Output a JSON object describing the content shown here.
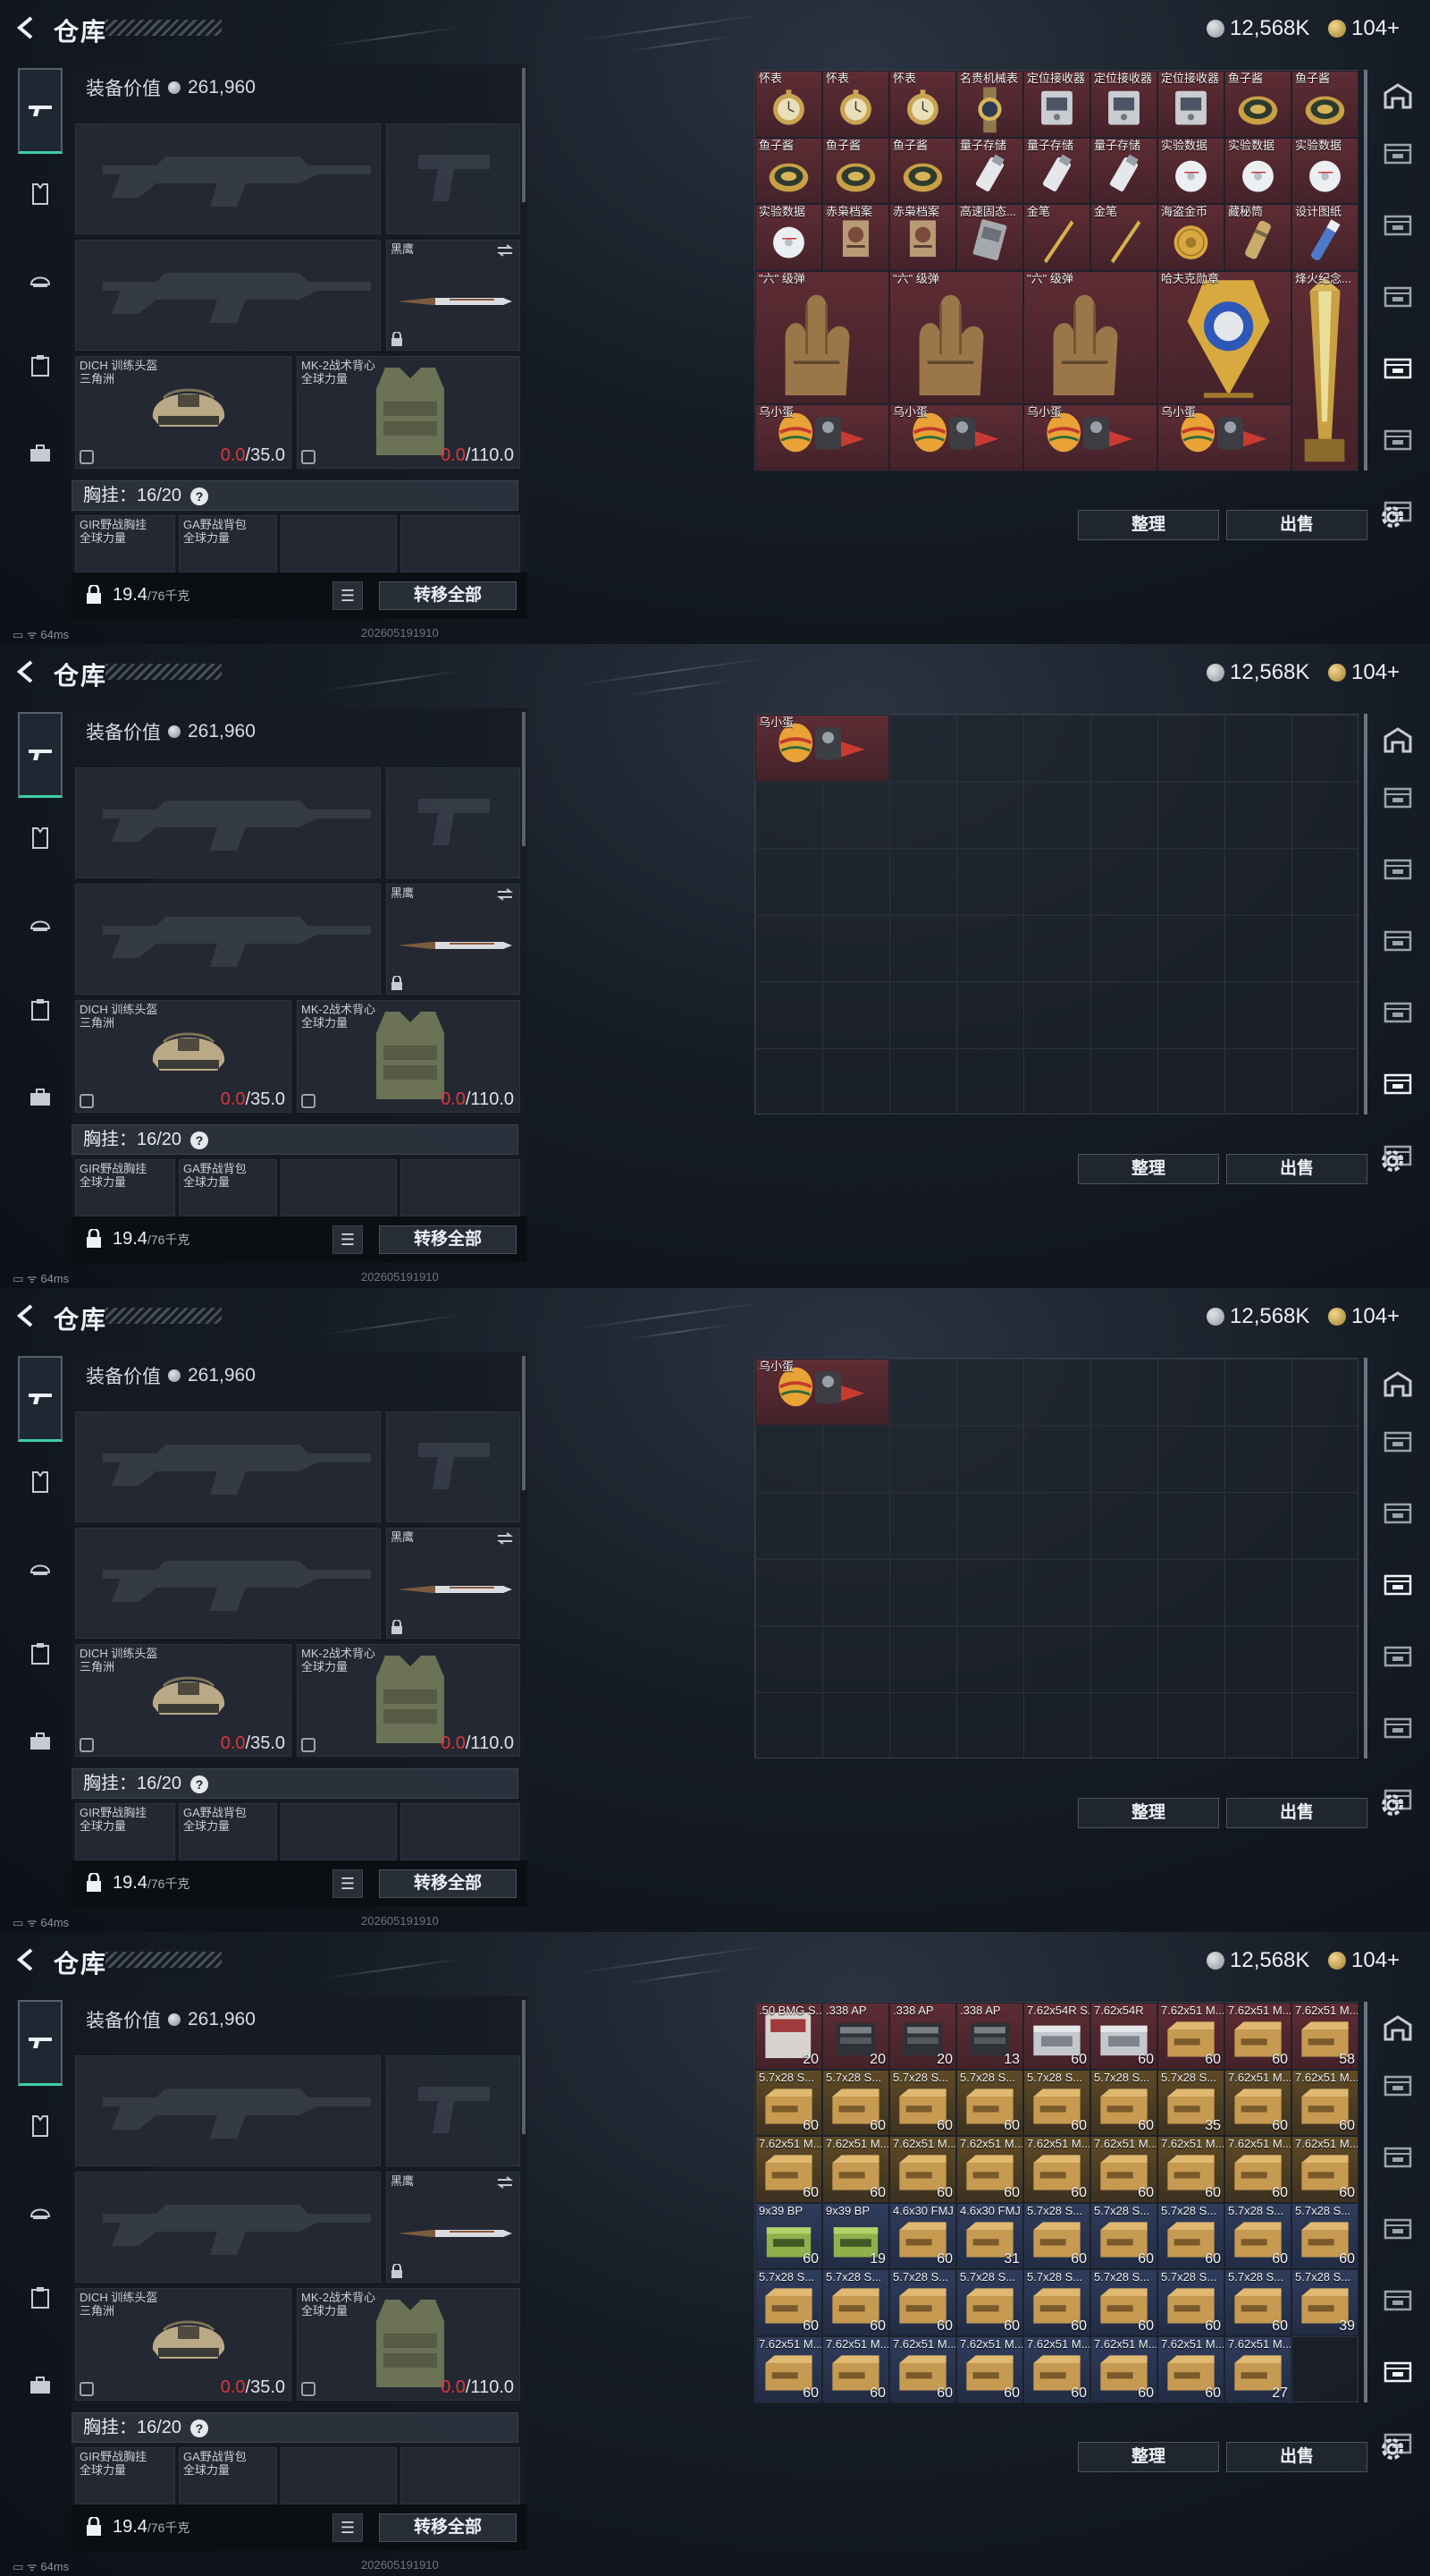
{
  "header": {
    "title": "仓库",
    "silver": "12,568K",
    "gold": "104+"
  },
  "equipment": {
    "value_label": "装备价值",
    "value": "261,960",
    "knife_label": "黑鹰",
    "helmet": {
      "name": "DICH 训练头盔",
      "sub": "三角洲",
      "cur": "0.0",
      "max": "/35.0"
    },
    "armor": {
      "name": "MK-2战术背心",
      "sub": "全球力量",
      "cur": "0.0",
      "max": "/110.0"
    },
    "chest_label": "胸挂：16/20",
    "bag1": {
      "name": "GIR野战胸挂",
      "sub": "全球力量"
    },
    "bag2": {
      "name": "GA野战背包",
      "sub": "全球力量"
    },
    "weight": "19.4",
    "weight_max": "/76千克",
    "transfer_label": "转移全部"
  },
  "actions": {
    "sort": "整理",
    "sell": "出售"
  },
  "status": {
    "ping": "64ms",
    "stamp": "202605191910"
  },
  "icons": [
    "back-icon",
    "gun-icon",
    "armor-icon",
    "helmet-icon",
    "clipboard-icon",
    "briefcase-icon",
    "gear-icon",
    "lock-icon",
    "list-icon",
    "help-icon"
  ],
  "panels": [
    {
      "cells": [
        {
          "c": 0,
          "r": 0,
          "w": 1,
          "h": 1,
          "label": "怀表",
          "bg": "red",
          "art": "watch"
        },
        {
          "c": 1,
          "r": 0,
          "w": 1,
          "h": 1,
          "label": "怀表",
          "bg": "red",
          "art": "watch"
        },
        {
          "c": 2,
          "r": 0,
          "w": 1,
          "h": 1,
          "label": "怀表",
          "bg": "red",
          "art": "watch"
        },
        {
          "c": 3,
          "r": 0,
          "w": 1,
          "h": 1,
          "label": "名贵机械表",
          "bg": "red",
          "art": "wrist"
        },
        {
          "c": 4,
          "r": 0,
          "w": 1,
          "h": 1,
          "label": "定位接收器",
          "bg": "red",
          "art": "device"
        },
        {
          "c": 5,
          "r": 0,
          "w": 1,
          "h": 1,
          "label": "定位接收器",
          "bg": "red",
          "art": "device"
        },
        {
          "c": 6,
          "r": 0,
          "w": 1,
          "h": 1,
          "label": "定位接收器",
          "bg": "red",
          "art": "device"
        },
        {
          "c": 7,
          "r": 0,
          "w": 1,
          "h": 1,
          "label": "鱼子酱",
          "bg": "red",
          "art": "tin"
        },
        {
          "c": 8,
          "r": 0,
          "w": 1,
          "h": 1,
          "label": "鱼子酱",
          "bg": "red",
          "art": "tin"
        },
        {
          "c": 0,
          "r": 1,
          "w": 1,
          "h": 1,
          "label": "鱼子酱",
          "bg": "red",
          "art": "tin"
        },
        {
          "c": 1,
          "r": 1,
          "w": 1,
          "h": 1,
          "label": "鱼子酱",
          "bg": "red",
          "art": "tin"
        },
        {
          "c": 2,
          "r": 1,
          "w": 1,
          "h": 1,
          "label": "鱼子酱",
          "bg": "red",
          "art": "tin"
        },
        {
          "c": 3,
          "r": 1,
          "w": 1,
          "h": 1,
          "label": "量子存储",
          "bg": "red",
          "art": "usb"
        },
        {
          "c": 4,
          "r": 1,
          "w": 1,
          "h": 1,
          "label": "量子存储",
          "bg": "red",
          "art": "usb"
        },
        {
          "c": 5,
          "r": 1,
          "w": 1,
          "h": 1,
          "label": "量子存储",
          "bg": "red",
          "art": "usb"
        },
        {
          "c": 6,
          "r": 1,
          "w": 1,
          "h": 1,
          "label": "实验数据",
          "bg": "red",
          "art": "disc"
        },
        {
          "c": 7,
          "r": 1,
          "w": 1,
          "h": 1,
          "label": "实验数据",
          "bg": "red",
          "art": "disc"
        },
        {
          "c": 8,
          "r": 1,
          "w": 1,
          "h": 1,
          "label": "实验数据",
          "bg": "red",
          "art": "disc"
        },
        {
          "c": 0,
          "r": 2,
          "w": 1,
          "h": 1,
          "label": "实验数据",
          "bg": "red",
          "art": "disc"
        },
        {
          "c": 1,
          "r": 2,
          "w": 1,
          "h": 1,
          "label": "赤枭档案",
          "bg": "red",
          "art": "file"
        },
        {
          "c": 2,
          "r": 2,
          "w": 1,
          "h": 1,
          "label": "赤枭档案",
          "bg": "red",
          "art": "file"
        },
        {
          "c": 3,
          "r": 2,
          "w": 1,
          "h": 1,
          "label": "高速固态...",
          "bg": "red",
          "art": "ssd"
        },
        {
          "c": 4,
          "r": 2,
          "w": 1,
          "h": 1,
          "label": "金笔",
          "bg": "red",
          "art": "pen"
        },
        {
          "c": 5,
          "r": 2,
          "w": 1,
          "h": 1,
          "label": "金笔",
          "bg": "red",
          "art": "pen"
        },
        {
          "c": 6,
          "r": 2,
          "w": 1,
          "h": 1,
          "label": "海盗金币",
          "bg": "red",
          "art": "coin"
        },
        {
          "c": 7,
          "r": 2,
          "w": 1,
          "h": 1,
          "label": "藏秘筒",
          "bg": "red",
          "art": "cyl"
        },
        {
          "c": 8,
          "r": 2,
          "w": 1,
          "h": 1,
          "label": "设计图纸",
          "bg": "red",
          "art": "tube"
        },
        {
          "c": 0,
          "r": 3,
          "w": 2,
          "h": 2,
          "label": "\"六\" 级弹",
          "bg": "red",
          "art": "hand"
        },
        {
          "c": 2,
          "r": 3,
          "w": 2,
          "h": 2,
          "label": "\"六\" 级弹",
          "bg": "red",
          "art": "hand"
        },
        {
          "c": 4,
          "r": 3,
          "w": 2,
          "h": 2,
          "label": "\"六\" 级弹",
          "bg": "red",
          "art": "hand"
        },
        {
          "c": 6,
          "r": 3,
          "w": 2,
          "h": 2,
          "label": "哈夫克勋章",
          "bg": "red",
          "art": "medal"
        },
        {
          "c": 8,
          "r": 3,
          "w": 1,
          "h": 3,
          "label": "烽火纪念...",
          "bg": "red",
          "art": "trophy"
        },
        {
          "c": 0,
          "r": 5,
          "w": 2,
          "h": 1,
          "label": "乌小蛋",
          "bg": "red",
          "art": "egg"
        },
        {
          "c": 2,
          "r": 5,
          "w": 2,
          "h": 1,
          "label": "乌小蛋",
          "bg": "red",
          "art": "egg"
        },
        {
          "c": 4,
          "r": 5,
          "w": 2,
          "h": 1,
          "label": "乌小蛋",
          "bg": "red",
          "art": "egg"
        },
        {
          "c": 6,
          "r": 5,
          "w": 2,
          "h": 1,
          "label": "乌小蛋",
          "bg": "red",
          "art": "egg"
        }
      ],
      "active_rtab": 4
    },
    {
      "cells": [
        {
          "c": 0,
          "r": 0,
          "w": 2,
          "h": 1,
          "label": "乌小蛋",
          "bg": "red",
          "art": "egg"
        }
      ],
      "active_rtab": 5
    },
    {
      "cells": [
        {
          "c": 0,
          "r": 0,
          "w": 2,
          "h": 1,
          "label": "乌小蛋",
          "bg": "red",
          "art": "egg"
        }
      ],
      "active_rtab": 3
    },
    {
      "cells": [
        {
          "c": 0,
          "r": 0,
          "w": 1,
          "h": 1,
          "label": ".50 BMG S...",
          "bg": "red",
          "art": "bmg",
          "count": "20"
        },
        {
          "c": 1,
          "r": 0,
          "w": 1,
          "h": 1,
          "label": ".338 AP",
          "bg": "red",
          "art": "mag",
          "count": "20"
        },
        {
          "c": 2,
          "r": 0,
          "w": 1,
          "h": 1,
          "label": ".338 AP",
          "bg": "red",
          "art": "mag",
          "count": "20"
        },
        {
          "c": 3,
          "r": 0,
          "w": 1,
          "h": 1,
          "label": ".338 AP",
          "bg": "red",
          "art": "mag",
          "count": "13"
        },
        {
          "c": 4,
          "r": 0,
          "w": 1,
          "h": 1,
          "label": "7.62x54R S...",
          "bg": "red",
          "art": "silverbox",
          "count": "60"
        },
        {
          "c": 5,
          "r": 0,
          "w": 1,
          "h": 1,
          "label": "7.62x54R",
          "bg": "red",
          "art": "silverbox",
          "count": "60"
        },
        {
          "c": 6,
          "r": 0,
          "w": 1,
          "h": 1,
          "label": "7.62x51 M...",
          "bg": "red",
          "art": "box",
          "count": "60"
        },
        {
          "c": 7,
          "r": 0,
          "w": 1,
          "h": 1,
          "label": "7.62x51 M...",
          "bg": "red",
          "art": "box",
          "count": "60"
        },
        {
          "c": 8,
          "r": 0,
          "w": 1,
          "h": 1,
          "label": "7.62x51 M...",
          "bg": "red",
          "art": "box",
          "count": "58"
        },
        {
          "c": 0,
          "r": 1,
          "w": 1,
          "h": 1,
          "label": "5.7x28 S...",
          "bg": "gold",
          "art": "box",
          "count": "60"
        },
        {
          "c": 1,
          "r": 1,
          "w": 1,
          "h": 1,
          "label": "5.7x28 S...",
          "bg": "gold",
          "art": "box",
          "count": "60"
        },
        {
          "c": 2,
          "r": 1,
          "w": 1,
          "h": 1,
          "label": "5.7x28 S...",
          "bg": "gold",
          "art": "box",
          "count": "60"
        },
        {
          "c": 3,
          "r": 1,
          "w": 1,
          "h": 1,
          "label": "5.7x28 S...",
          "bg": "gold",
          "art": "box",
          "count": "60"
        },
        {
          "c": 4,
          "r": 1,
          "w": 1,
          "h": 1,
          "label": "5.7x28 S...",
          "bg": "gold",
          "art": "box",
          "count": "60"
        },
        {
          "c": 5,
          "r": 1,
          "w": 1,
          "h": 1,
          "label": "5.7x28 S...",
          "bg": "gold",
          "art": "box",
          "count": "60"
        },
        {
          "c": 6,
          "r": 1,
          "w": 1,
          "h": 1,
          "label": "5.7x28 S...",
          "bg": "gold",
          "art": "box",
          "count": "35"
        },
        {
          "c": 7,
          "r": 1,
          "w": 1,
          "h": 1,
          "label": "7.62x51 M...",
          "bg": "gold",
          "art": "box",
          "count": "60"
        },
        {
          "c": 8,
          "r": 1,
          "w": 1,
          "h": 1,
          "label": "7.62x51 M...",
          "bg": "gold",
          "art": "box",
          "count": "60"
        },
        {
          "c": 0,
          "r": 2,
          "w": 1,
          "h": 1,
          "label": "7.62x51 M...",
          "bg": "gold",
          "art": "box",
          "count": "60"
        },
        {
          "c": 1,
          "r": 2,
          "w": 1,
          "h": 1,
          "label": "7.62x51 M...",
          "bg": "gold",
          "art": "box",
          "count": "60"
        },
        {
          "c": 2,
          "r": 2,
          "w": 1,
          "h": 1,
          "label": "7.62x51 M...",
          "bg": "gold",
          "art": "box",
          "count": "60"
        },
        {
          "c": 3,
          "r": 2,
          "w": 1,
          "h": 1,
          "label": "7.62x51 M...",
          "bg": "gold",
          "art": "box",
          "count": "60"
        },
        {
          "c": 4,
          "r": 2,
          "w": 1,
          "h": 1,
          "label": "7.62x51 M...",
          "bg": "gold",
          "art": "box",
          "count": "60"
        },
        {
          "c": 5,
          "r": 2,
          "w": 1,
          "h": 1,
          "label": "7.62x51 M...",
          "bg": "gold",
          "art": "box",
          "count": "60"
        },
        {
          "c": 6,
          "r": 2,
          "w": 1,
          "h": 1,
          "label": "7.62x51 M...",
          "bg": "gold",
          "art": "box",
          "count": "60"
        },
        {
          "c": 7,
          "r": 2,
          "w": 1,
          "h": 1,
          "label": "7.62x51 M...",
          "bg": "gold",
          "art": "box",
          "count": "60"
        },
        {
          "c": 8,
          "r": 2,
          "w": 1,
          "h": 1,
          "label": "7.62x51 M...",
          "bg": "gold",
          "art": "box",
          "count": "60"
        },
        {
          "c": 0,
          "r": 3,
          "w": 1,
          "h": 1,
          "label": "9x39 BP",
          "bg": "blue",
          "art": "greenbox",
          "count": "60"
        },
        {
          "c": 1,
          "r": 3,
          "w": 1,
          "h": 1,
          "label": "9x39 BP",
          "bg": "blue",
          "art": "greenbox",
          "count": "19"
        },
        {
          "c": 2,
          "r": 3,
          "w": 1,
          "h": 1,
          "label": "4.6x30 FMJ SX",
          "bg": "blue",
          "art": "box",
          "count": "60"
        },
        {
          "c": 3,
          "r": 3,
          "w": 1,
          "h": 1,
          "label": "4.6x30 FMJ SX",
          "bg": "blue",
          "art": "box",
          "count": "31"
        },
        {
          "c": 4,
          "r": 3,
          "w": 1,
          "h": 1,
          "label": "5.7x28 S...",
          "bg": "blue",
          "art": "box",
          "count": "60"
        },
        {
          "c": 5,
          "r": 3,
          "w": 1,
          "h": 1,
          "label": "5.7x28 S...",
          "bg": "blue",
          "art": "box",
          "count": "60"
        },
        {
          "c": 6,
          "r": 3,
          "w": 1,
          "h": 1,
          "label": "5.7x28 S...",
          "bg": "blue",
          "art": "box",
          "count": "60"
        },
        {
          "c": 7,
          "r": 3,
          "w": 1,
          "h": 1,
          "label": "5.7x28 S...",
          "bg": "blue",
          "art": "box",
          "count": "60"
        },
        {
          "c": 8,
          "r": 3,
          "w": 1,
          "h": 1,
          "label": "5.7x28 S...",
          "bg": "blue",
          "art": "box",
          "count": "60"
        },
        {
          "c": 0,
          "r": 4,
          "w": 1,
          "h": 1,
          "label": "5.7x28 S...",
          "bg": "blue",
          "art": "box",
          "count": "60"
        },
        {
          "c": 1,
          "r": 4,
          "w": 1,
          "h": 1,
          "label": "5.7x28 S...",
          "bg": "blue",
          "art": "box",
          "count": "60"
        },
        {
          "c": 2,
          "r": 4,
          "w": 1,
          "h": 1,
          "label": "5.7x28 S...",
          "bg": "blue",
          "art": "box",
          "count": "60"
        },
        {
          "c": 3,
          "r": 4,
          "w": 1,
          "h": 1,
          "label": "5.7x28 S...",
          "bg": "blue",
          "art": "box",
          "count": "60"
        },
        {
          "c": 4,
          "r": 4,
          "w": 1,
          "h": 1,
          "label": "5.7x28 S...",
          "bg": "blue",
          "art": "box",
          "count": "60"
        },
        {
          "c": 5,
          "r": 4,
          "w": 1,
          "h": 1,
          "label": "5.7x28 S...",
          "bg": "blue",
          "art": "box",
          "count": "60"
        },
        {
          "c": 6,
          "r": 4,
          "w": 1,
          "h": 1,
          "label": "5.7x28 S...",
          "bg": "blue",
          "art": "box",
          "count": "60"
        },
        {
          "c": 7,
          "r": 4,
          "w": 1,
          "h": 1,
          "label": "5.7x28 S...",
          "bg": "blue",
          "art": "box",
          "count": "60"
        },
        {
          "c": 8,
          "r": 4,
          "w": 1,
          "h": 1,
          "label": "5.7x28 S...",
          "bg": "blue",
          "art": "box",
          "count": "39"
        },
        {
          "c": 0,
          "r": 5,
          "w": 1,
          "h": 1,
          "label": "7.62x51 M...",
          "bg": "blue",
          "art": "box",
          "count": "60"
        },
        {
          "c": 1,
          "r": 5,
          "w": 1,
          "h": 1,
          "label": "7.62x51 M...",
          "bg": "blue",
          "art": "box",
          "count": "60"
        },
        {
          "c": 2,
          "r": 5,
          "w": 1,
          "h": 1,
          "label": "7.62x51 M...",
          "bg": "blue",
          "art": "box",
          "count": "60"
        },
        {
          "c": 3,
          "r": 5,
          "w": 1,
          "h": 1,
          "label": "7.62x51 M...",
          "bg": "blue",
          "art": "box",
          "count": "60"
        },
        {
          "c": 4,
          "r": 5,
          "w": 1,
          "h": 1,
          "label": "7.62x51 M...",
          "bg": "blue",
          "art": "box",
          "count": "60"
        },
        {
          "c": 5,
          "r": 5,
          "w": 1,
          "h": 1,
          "label": "7.62x51 M...",
          "bg": "blue",
          "art": "box",
          "count": "60"
        },
        {
          "c": 6,
          "r": 5,
          "w": 1,
          "h": 1,
          "label": "7.62x51 M...",
          "bg": "blue",
          "art": "box",
          "count": "60"
        },
        {
          "c": 7,
          "r": 5,
          "w": 1,
          "h": 1,
          "label": "7.62x51 M...",
          "bg": "blue",
          "art": "box",
          "count": "27"
        }
      ],
      "active_rtab": 5
    }
  ]
}
